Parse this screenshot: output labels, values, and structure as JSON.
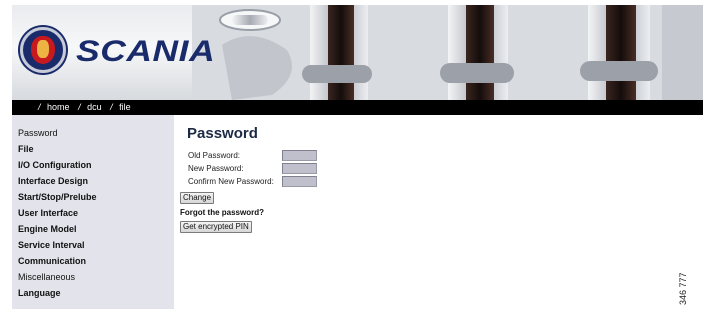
{
  "header": {
    "brand": "SCANIA"
  },
  "breadcrumb": {
    "items": [
      "home",
      "dcu",
      "file"
    ],
    "separator": "/"
  },
  "sidebar": {
    "items": [
      {
        "label": "Password",
        "bold": false
      },
      {
        "label": "File",
        "bold": true
      },
      {
        "label": "I/O Configuration",
        "bold": true
      },
      {
        "label": "Interface Design",
        "bold": true
      },
      {
        "label": "Start/Stop/Prelube",
        "bold": true
      },
      {
        "label": "User Interface",
        "bold": true
      },
      {
        "label": "Engine Model",
        "bold": true
      },
      {
        "label": "Service Interval",
        "bold": true
      },
      {
        "label": "Communication",
        "bold": true
      },
      {
        "label": "Miscellaneous",
        "bold": false
      },
      {
        "label": "Language",
        "bold": true
      }
    ]
  },
  "main": {
    "title": "Password",
    "fields": [
      {
        "label": "Old Password:",
        "value": ""
      },
      {
        "label": "New Password:",
        "value": ""
      },
      {
        "label": "Confirm New Password:",
        "value": ""
      }
    ],
    "change_label": "Change",
    "forgot_label": "Forgot the password?",
    "pin_label": "Get encrypted PIN"
  },
  "figure_code": "346 777",
  "colors": {
    "sidebar_bg": "#e3e3eb",
    "crumbbar_bg": "#000000",
    "brand_blue": "#1a2b6b",
    "field_bg": "#c0c0cc"
  }
}
